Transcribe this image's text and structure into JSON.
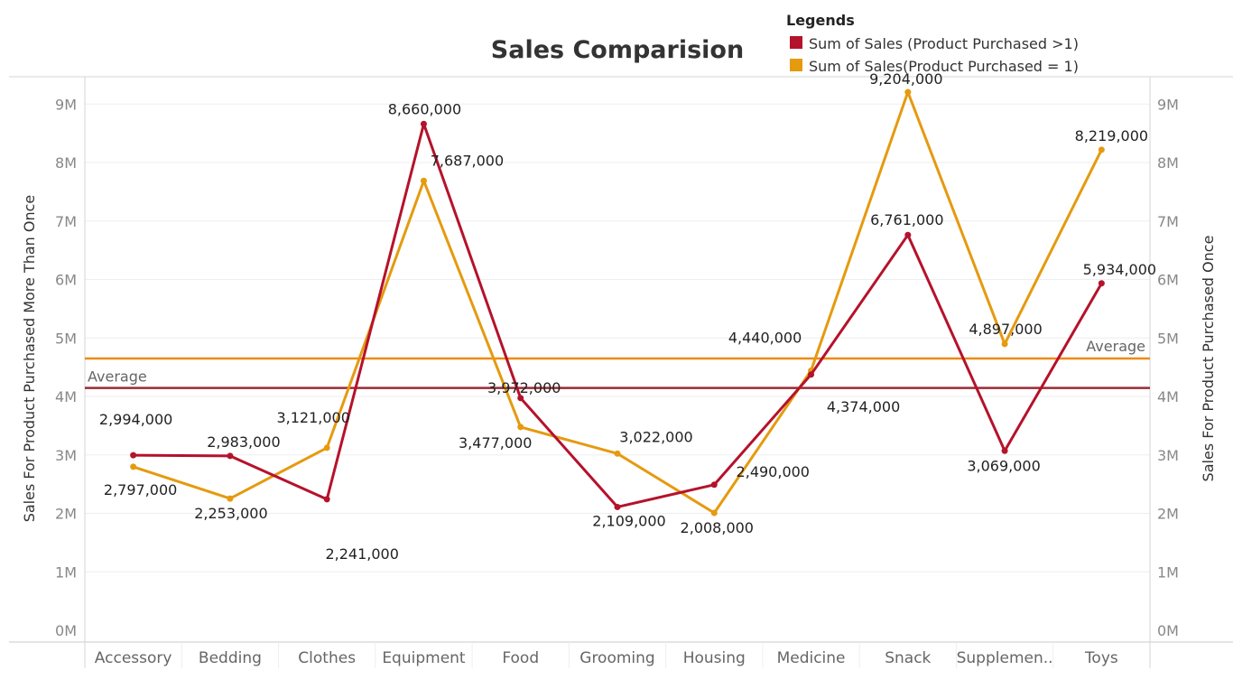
{
  "chart_data": {
    "type": "line",
    "title": "Sales Comparision",
    "legend_title": "Legends",
    "legend_position": "top-right",
    "categories": [
      "Accessory",
      "Bedding",
      "Clothes",
      "Equipment",
      "Food",
      "Grooming",
      "Housing",
      "Medicine",
      "Snack",
      "Supplemen..",
      "Toys"
    ],
    "series": [
      {
        "name": "Sum of Sales (Product Purchased >1)",
        "color": "#b5122b",
        "values": [
          2994000,
          2983000,
          2241000,
          8660000,
          3972000,
          2109000,
          2490000,
          4374000,
          6761000,
          3069000,
          5934000
        ],
        "labels": [
          "2,994,000",
          "2,983,000",
          "2,241,000",
          "8,660,000",
          "3,972,000",
          "2,109,000",
          "2,490,000",
          "4,374,000",
          "6,761,000",
          "3,069,000",
          "5,934,000"
        ],
        "average": 4144000
      },
      {
        "name": "Sum of Sales(Product Purchased = 1)",
        "color": "#e59a0f",
        "values": [
          2797000,
          2253000,
          3121000,
          7687000,
          3477000,
          3022000,
          2008000,
          4440000,
          9204000,
          4897000,
          8219000
        ],
        "labels": [
          "2,797,000",
          "2,253,000",
          "3,121,000",
          "7,687,000",
          "3,477,000",
          "3,022,000",
          "2,008,000",
          "4,440,000",
          "9,204,000",
          "4,897,000",
          "8,219,000"
        ],
        "average": 4648000
      }
    ],
    "average_label": "Average",
    "ylabel_left": "Sales For Product Purchased More Than Once",
    "ylabel_right": "Sales For Product Purchased Once",
    "y_ticks": [
      "0M",
      "1M",
      "2M",
      "3M",
      "4M",
      "5M",
      "6M",
      "7M",
      "8M",
      "9M"
    ],
    "ylim": [
      0,
      9650000
    ],
    "grid": true
  }
}
